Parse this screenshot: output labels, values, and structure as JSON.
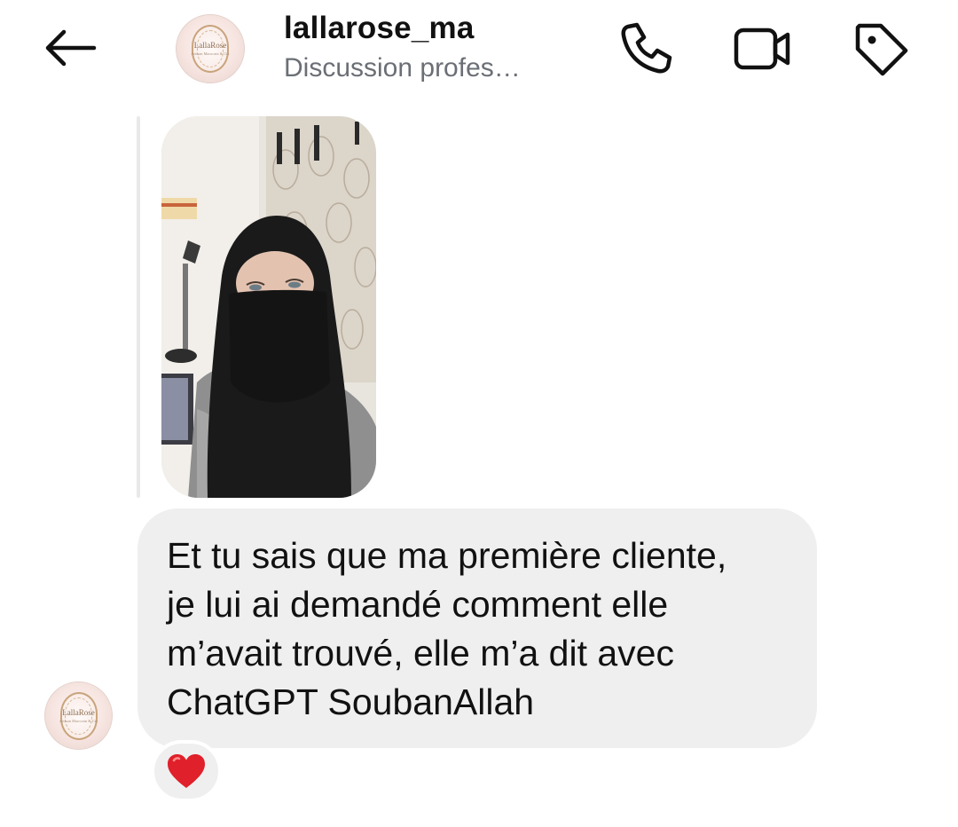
{
  "header": {
    "username": "lallarose_ma",
    "subtitle": "Discussion profes…",
    "avatar_brand": "LallaRose",
    "avatar_brand_sub": "Artisan Marocain & Cie"
  },
  "icons": {
    "back": "arrow-left-icon",
    "call": "phone-icon",
    "video": "video-camera-icon",
    "tag": "tag-icon",
    "reaction": "heart-icon"
  },
  "conversation": {
    "shared_media": {
      "type": "photo"
    },
    "message": {
      "text": "Et tu sais que ma première cliente,\nje lui ai demandé comment elle\nm’avait trouvé, elle m’a dit avec\nChatGPT SoubanAllah"
    },
    "reaction": {
      "emoji": "heart",
      "color": "#e0202a"
    }
  },
  "colors": {
    "bubble": "#efefef",
    "subtitle": "#6b6f75",
    "icon": "#111111"
  }
}
